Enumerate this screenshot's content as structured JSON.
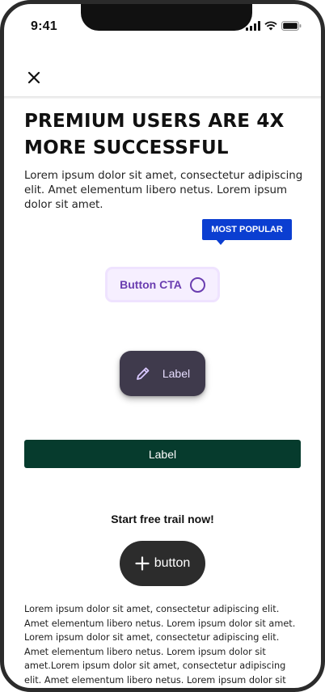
{
  "status_bar": {
    "time": "9:41"
  },
  "headline": "PREMIUM USERS ARE 4X MORE SUCCESSFUL",
  "intro": "Lorem ipsum dolor sit amet, consectetur adipiscing elit. Amet elementum libero netus. Lorem ipsum dolor sit amet.",
  "badge": {
    "label": "MOST POPULAR",
    "color": "#0b3ed1"
  },
  "cta": {
    "label": "Button CTA",
    "color": "#6a3db0"
  },
  "fab": {
    "label": "Label",
    "icon": "pencil-icon"
  },
  "primary_button": {
    "label": "Label",
    "color": "#063b2d"
  },
  "trial": {
    "title": "Start free trail now!"
  },
  "pill_button": {
    "label": "button",
    "icon": "plus-icon"
  },
  "body_text": "Lorem ipsum dolor sit amet, consectetur adipiscing elit. Amet elementum libero netus. Lorem ipsum dolor sit amet. Lorem ipsum dolor sit amet, consectetur adipiscing elit. Amet elementum libero netus. Lorem ipsum dolor sit amet.Lorem ipsum dolor sit amet, consectetur adipiscing elit. Amet elementum libero netus. Lorem ipsum dolor sit"
}
